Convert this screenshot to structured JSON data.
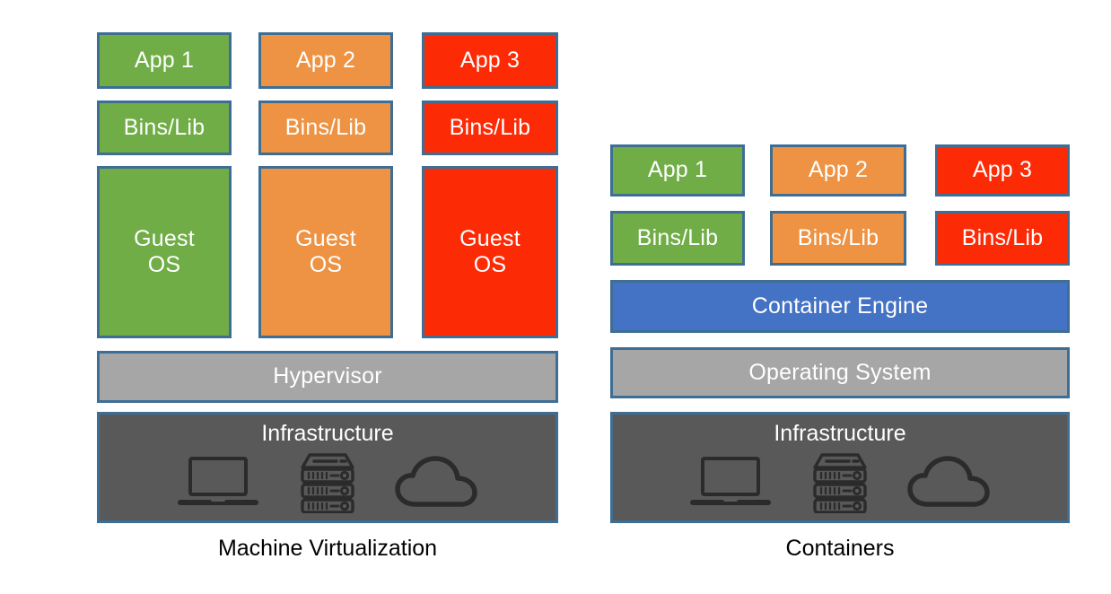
{
  "diagram": {
    "title_left": "Machine Virtualization",
    "title_right": "Containers",
    "colors": {
      "app1": "#70AD47",
      "app2": "#ED9343",
      "app3": "#FC2B06",
      "border": "#3E6E94",
      "hypervisor": "#A6A6A6",
      "operating_system": "#A6A6A6",
      "container_engine": "#4472C4",
      "infrastructure": "#595959",
      "text_light": "#FFFFFF",
      "caption_text": "#000000"
    }
  },
  "left_panel": {
    "caption": "Machine Virtualization",
    "stacks": [
      {
        "app": "App 1",
        "bins": "Bins/Lib",
        "guest": "Guest\nOS",
        "color": "green"
      },
      {
        "app": "App 2",
        "bins": "Bins/Lib",
        "guest": "Guest\nOS",
        "color": "orange"
      },
      {
        "app": "App 3",
        "bins": "Bins/Lib",
        "guest": "Guest\nOS",
        "color": "red"
      }
    ],
    "hypervisor": "Hypervisor",
    "infrastructure": "Infrastructure",
    "infrastructure_icons": [
      "laptop-icon",
      "server-rack-icon",
      "cloud-icon"
    ]
  },
  "right_panel": {
    "caption": "Containers",
    "stacks": [
      {
        "app": "App 1",
        "bins": "Bins/Lib",
        "color": "green"
      },
      {
        "app": "App 2",
        "bins": "Bins/Lib",
        "color": "orange"
      },
      {
        "app": "App 3",
        "bins": "Bins/Lib",
        "color": "red"
      }
    ],
    "container_engine": "Container Engine",
    "operating_system": "Operating System",
    "infrastructure": "Infrastructure",
    "infrastructure_icons": [
      "laptop-icon",
      "server-rack-icon",
      "cloud-icon"
    ]
  }
}
